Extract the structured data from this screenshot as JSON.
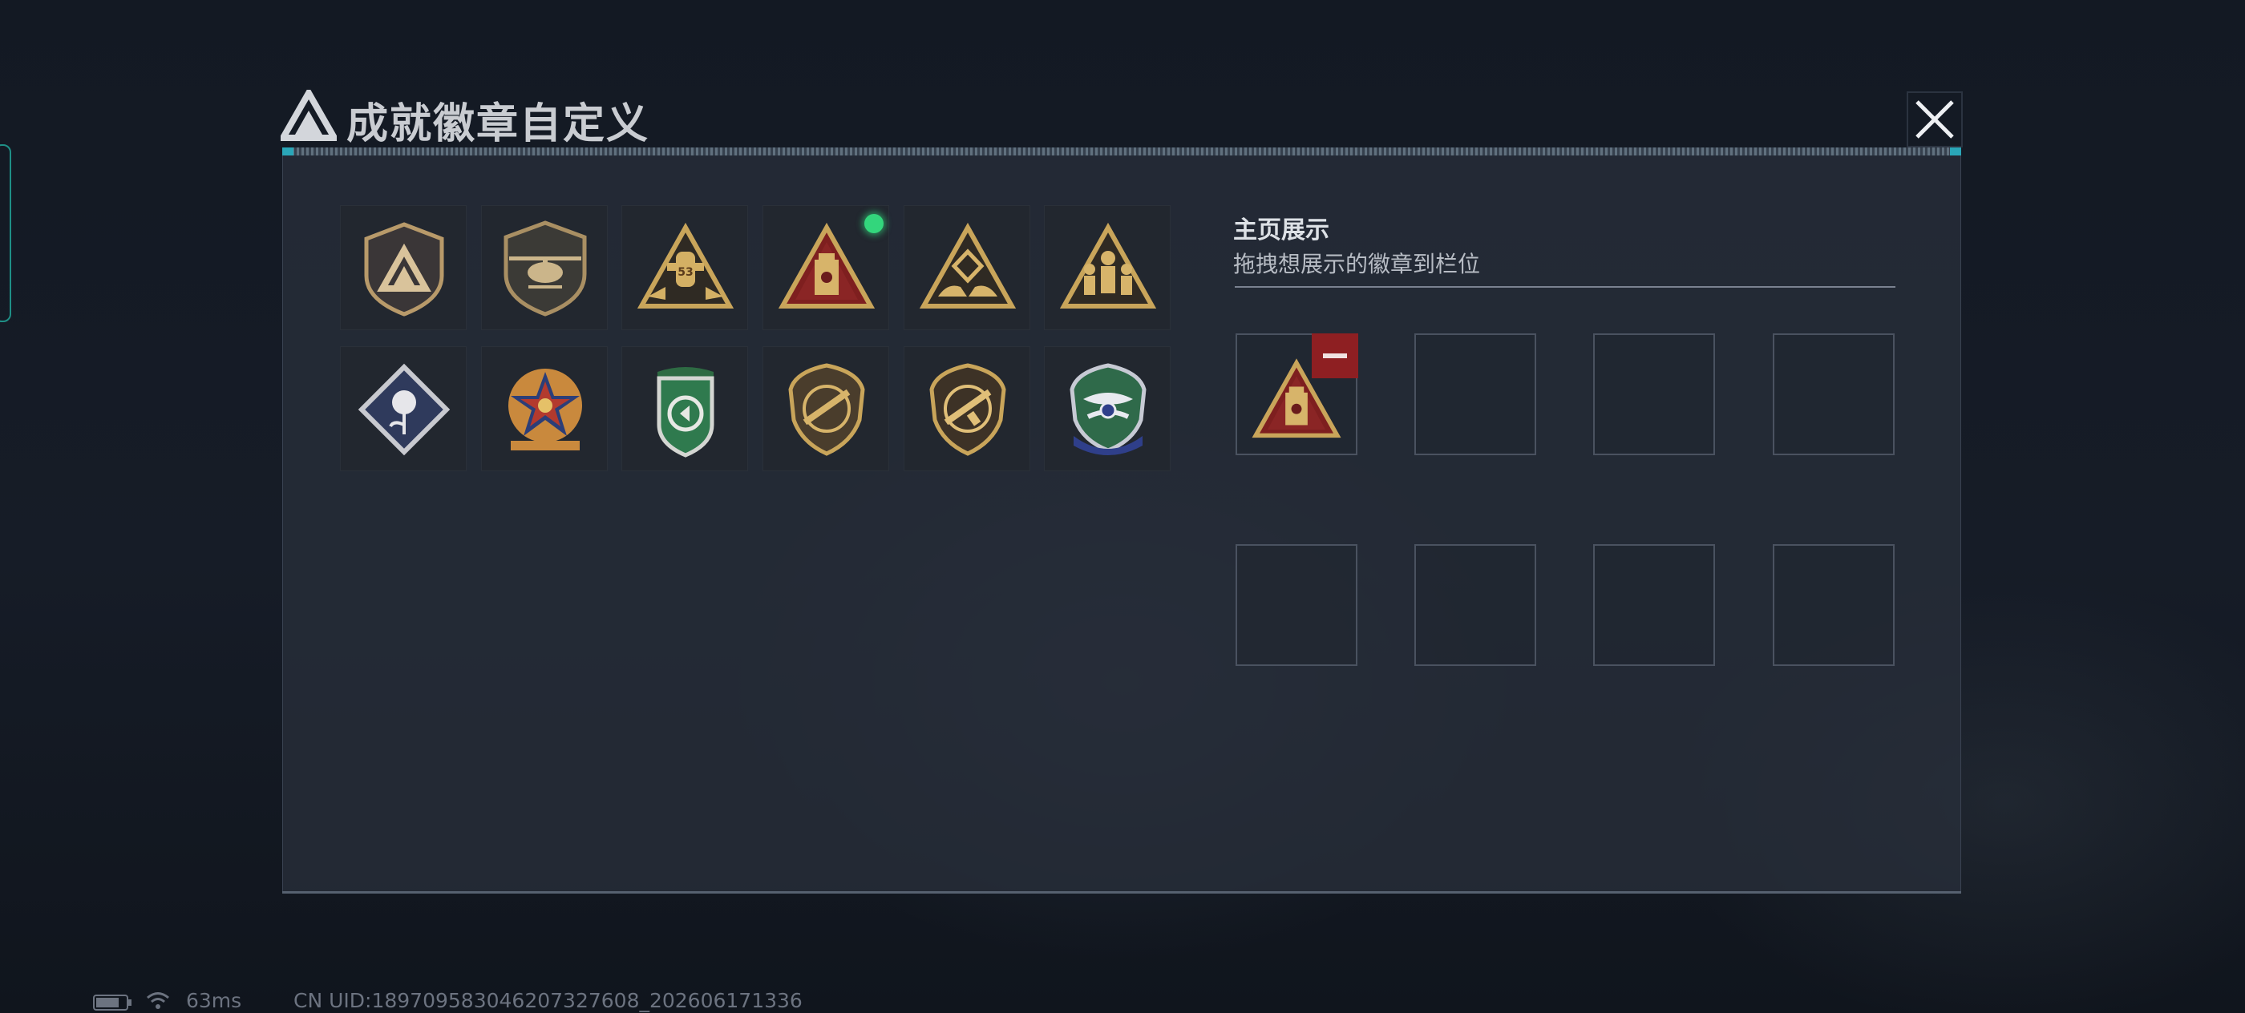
{
  "dialog": {
    "title": "成就徽章自定义"
  },
  "badges": [
    {
      "name": "shield-triangle-badge",
      "selected": false,
      "new": false
    },
    {
      "name": "helicopter-badge",
      "selected": false,
      "new": false
    },
    {
      "name": "transport-53-badge",
      "selected": false,
      "new": false
    },
    {
      "name": "supply-crate-badge",
      "selected": true,
      "new": true
    },
    {
      "name": "hands-diamond-badge",
      "selected": false,
      "new": false
    },
    {
      "name": "squad-soldiers-badge",
      "selected": false,
      "new": false
    },
    {
      "name": "rose-diamond-badge",
      "selected": false,
      "new": false
    },
    {
      "name": "star-medal-badge",
      "selected": false,
      "new": false
    },
    {
      "name": "green-crest-badge",
      "selected": false,
      "new": false
    },
    {
      "name": "rifle-shield-badge-1",
      "selected": false,
      "new": false
    },
    {
      "name": "rifle-shield-badge-2",
      "selected": false,
      "new": false
    },
    {
      "name": "wings-shield-badge",
      "selected": false,
      "new": false
    }
  ],
  "showcase": {
    "title": "主页展示",
    "subtitle": "拖拽想展示的徽章到栏位",
    "slots": [
      {
        "badge": "supply-crate-badge"
      },
      {
        "badge": null
      },
      {
        "badge": null
      },
      {
        "badge": null
      },
      {
        "badge": null
      },
      {
        "badge": null
      },
      {
        "badge": null
      },
      {
        "badge": null
      }
    ]
  },
  "status_bar": {
    "ping": "63ms",
    "uid": "CN UID:189709583046207327608_202606171336"
  },
  "colors": {
    "accent_new": "#33d67c",
    "remove": "#8e1f22",
    "badge_gold": "#c9a55a"
  }
}
